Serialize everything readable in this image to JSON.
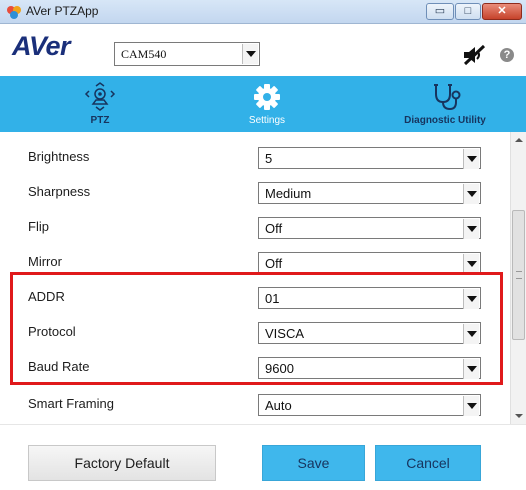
{
  "window": {
    "title": "AVer PTZApp",
    "controls": {
      "minimize": "▭",
      "maximize": "□",
      "close": "✕"
    }
  },
  "toolbar": {
    "logo": "AVer",
    "camera_select": "CAM540",
    "icons": [
      "speaker-muted-icon",
      "help-icon"
    ],
    "help_glyph": "?"
  },
  "nav": {
    "tabs": [
      {
        "label": "PTZ",
        "icon": "ptz-camera-icon",
        "active": false
      },
      {
        "label": "Settings",
        "icon": "gear-icon",
        "active": true
      },
      {
        "label": "Diagnostic Utility",
        "icon": "stethoscope-icon",
        "active": false
      }
    ]
  },
  "settings": {
    "rows": [
      {
        "label": "Brightness",
        "value": "5"
      },
      {
        "label": "Sharpness",
        "value": "Medium"
      },
      {
        "label": "Flip",
        "value": "Off"
      },
      {
        "label": "Mirror",
        "value": "Off"
      },
      {
        "label": "ADDR",
        "value": "01"
      },
      {
        "label": "Protocol",
        "value": "VISCA"
      },
      {
        "label": "Baud Rate",
        "value": "9600"
      },
      {
        "label": "Smart Framing",
        "value": "Auto"
      }
    ]
  },
  "footer": {
    "factory_default": "Factory Default",
    "save": "Save",
    "cancel": "Cancel"
  },
  "colors": {
    "nav_bg": "#32b1e8",
    "highlight_border": "#e0191b",
    "button_blue": "#3fb7ec"
  }
}
